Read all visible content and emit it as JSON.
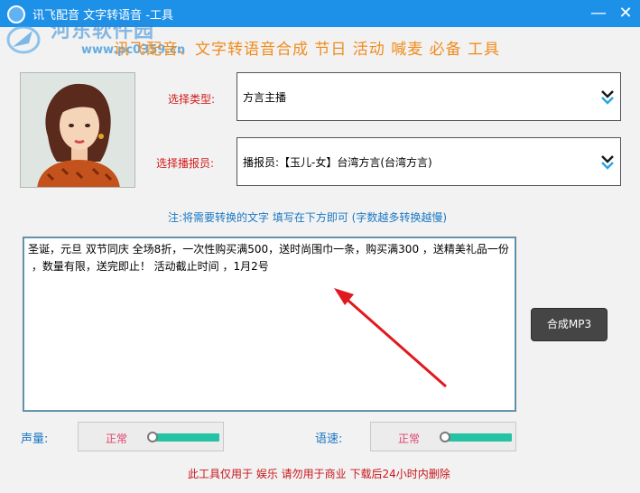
{
  "window": {
    "title": "讯飞配音 文字转语音 -工具"
  },
  "watermark": {
    "brand": "河东软件园",
    "url": "www.pc0359.cn"
  },
  "headline": "讯飞配音、文字转语音合成 节日 活动 喊麦  必备 工具",
  "type_field": {
    "label": "选择类型:",
    "value": "方言主播"
  },
  "speaker_field": {
    "label": "选择播报员:",
    "value": "播报员:【玉儿-女】台湾方言(台湾方言)"
  },
  "note": "注:将需要转换的文字 填写在下方即可 (字数越多转换越慢)",
  "text_input": {
    "value": "圣诞，元旦 双节同庆 全场8折，一次性购买满500，送时尚围巾一条，购买满300 ，送精美礼品一份\n ，数量有限，送完即止！ 活动截止时间 ，1月2号"
  },
  "synthesize_button": "合成MP3",
  "volume": {
    "label": "声量:",
    "value_text": "正常",
    "level": 0
  },
  "speed": {
    "label": "语速:",
    "value_text": "正常",
    "level": 0
  },
  "footer_notice": "此工具仅用于 娱乐 请勿用于商业 下载后24小时内删除",
  "colors": {
    "titlebar": "#1d90e8",
    "headline": "#f08c1d",
    "label_red": "#d11b1b",
    "note_blue": "#1b78c4",
    "slider_fill": "#26c2a4",
    "arrow": "#e0191f"
  }
}
